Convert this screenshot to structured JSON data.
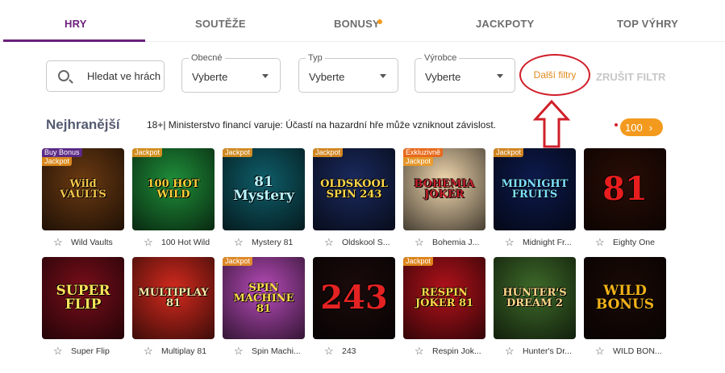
{
  "tabs": [
    {
      "label": "HRY"
    },
    {
      "label": "SOUTĚŽE"
    },
    {
      "label": "BONUSY"
    },
    {
      "label": "JACKPOTY"
    },
    {
      "label": "TOP VÝHRY"
    }
  ],
  "filters": {
    "search_placeholder": "Hledat ve hrách",
    "general": {
      "legend": "Obecné",
      "value": "Vyberte"
    },
    "type": {
      "legend": "Typ",
      "value": "Vyberte"
    },
    "provider": {
      "legend": "Výrobce",
      "value": "Vyberte"
    },
    "more_label": "Další filtry",
    "clear_label": "ZRUŠIT FILTR"
  },
  "section": {
    "title": "Nejhranější",
    "warning": "18+| Ministerstvo financí varuje: Účastí na hazardní hře může vzniknout závislost.",
    "count": "100",
    "count_chevron": "›"
  },
  "games": [
    {
      "name": "Wild Vaults",
      "art": "Wild VAULTS",
      "badges": [
        "Buy Bonus",
        "Jackpot"
      ],
      "bg": "#6b3a12",
      "fg": "#f6c64a"
    },
    {
      "name": "100 Hot Wild",
      "art": "100 HOT WILD",
      "badges": [
        "Jackpot"
      ],
      "bg": "#1f8f3a",
      "fg": "#ffd23a"
    },
    {
      "name": "Mystery 81",
      "art": "81 Mystery",
      "badges": [
        "Jackpot"
      ],
      "bg": "#0f5e6a",
      "fg": "#b9f4ff"
    },
    {
      "name": "Oldskool S...",
      "art": "OLDSKOOL SPIN 243",
      "badges": [
        "Jackpot"
      ],
      "bg": "#1a2a5e",
      "fg": "#ffd84a"
    },
    {
      "name": "Bohemia J...",
      "art": "BOHEMIA JOKER",
      "badges": [
        "Exkluzivně",
        "Jackpot"
      ],
      "bg": "#f3d9b0",
      "fg": "#c21f2a"
    },
    {
      "name": "Midnight Fr...",
      "art": "MIDNIGHT FRUITS",
      "badges": [
        "Jackpot"
      ],
      "bg": "#0d1b4e",
      "fg": "#7ee0ff"
    },
    {
      "name": "Eighty One",
      "art": "81",
      "badges": [],
      "bg": "#2a0d06",
      "fg": "#e81d1d"
    },
    {
      "name": "Super Flip",
      "art": "SUPER FLIP",
      "badges": [],
      "bg": "#7a0e1a",
      "fg": "#ffe25a"
    },
    {
      "name": "Multiplay 81",
      "art": "MULTIPLAY 81",
      "badges": [],
      "bg": "#d42a1e",
      "fg": "#ffe9a8"
    },
    {
      "name": "Spin Machi...",
      "art": "SPIN MACHINE 81",
      "badges": [
        "Jackpot"
      ],
      "bg": "#b64bb8",
      "fg": "#ffe04a"
    },
    {
      "name": "243",
      "art": "243",
      "badges": [],
      "bg": "#1b0b0b",
      "fg": "#e42222"
    },
    {
      "name": "Respin Jok...",
      "art": "RESPIN JOKER 81",
      "badges": [
        "Jackpot"
      ],
      "bg": "#b3121b",
      "fg": "#ffd84a"
    },
    {
      "name": "Hunter's Dr...",
      "art": "HUNTER'S DREAM 2",
      "badges": [],
      "bg": "#3e6b2a",
      "fg": "#ffd88a"
    },
    {
      "name": "WILD BON...",
      "art": "WILD BONUS",
      "badges": [],
      "bg": "#1a0a06",
      "fg": "#f4b21a"
    }
  ],
  "colors": {
    "accent": "#6b1f7a",
    "orange": "#f39a1e",
    "annotation_red": "#d01f2a"
  }
}
